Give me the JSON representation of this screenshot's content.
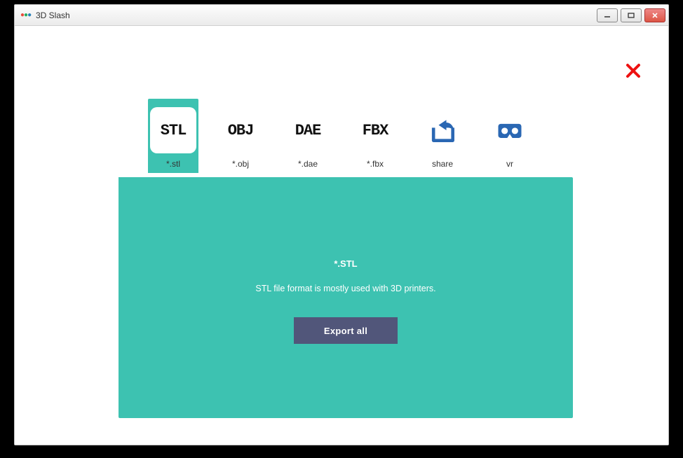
{
  "window": {
    "title": "3D Slash"
  },
  "tabs": {
    "stl": {
      "icon_text": "STL",
      "label": "*.stl"
    },
    "obj": {
      "icon_text": "OBJ",
      "label": "*.obj"
    },
    "dae": {
      "icon_text": "DAE",
      "label": "*.dae"
    },
    "fbx": {
      "icon_text": "FBX",
      "label": "*.fbx"
    },
    "share": {
      "label": "share"
    },
    "vr": {
      "label": "vr"
    }
  },
  "panel": {
    "title": "*.STL",
    "description": "STL file format is mostly used with 3D printers.",
    "export_label": "Export all"
  },
  "colors": {
    "accent_teal": "#3dc2b1",
    "button_dark": "#51567a",
    "close_red": "#e11"
  }
}
